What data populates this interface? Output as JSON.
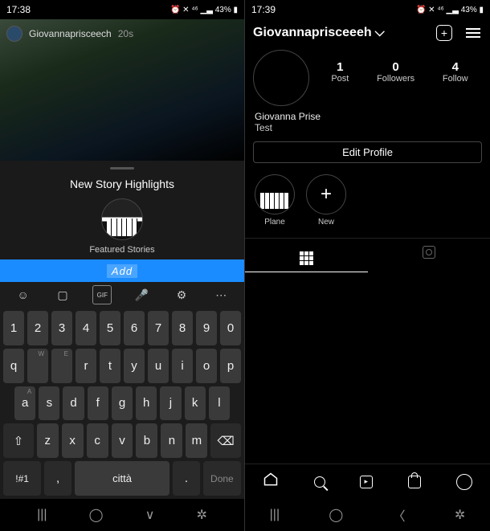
{
  "left": {
    "status": {
      "time": "17:38",
      "icons": "⏰ ✕ ⁴⁶ ▁▃ 43% ▮"
    },
    "story": {
      "user": "Giovannaprisceech",
      "age": "20s"
    },
    "sheet": {
      "title": "New Story Highlights",
      "subtitle": "Featured Stories",
      "add": "Add"
    },
    "kb": {
      "row1": [
        "1",
        "2",
        "3",
        "4",
        "5",
        "6",
        "7",
        "8",
        "9",
        "0"
      ],
      "row2": [
        "q",
        "w",
        "e",
        "r",
        "t",
        "y",
        "u",
        "i",
        "o",
        "p"
      ],
      "row3": [
        "a",
        "s",
        "d",
        "f",
        "g",
        "h",
        "j",
        "k",
        "l"
      ],
      "row4_shift": "⇧",
      "row4": [
        "z",
        "x",
        "c",
        "v",
        "b",
        "n",
        "m"
      ],
      "row4_bksp": "⌫",
      "row5": {
        "sym": "!#1",
        "comma": ",",
        "space": "città",
        "period": ".",
        "done": "Done"
      }
    }
  },
  "right": {
    "status": {
      "time": "17:39",
      "icons": "⏰ ✕ ⁴⁶ ▁▃ 43% ▮"
    },
    "username": "Giovannaprisceeeh",
    "stats": {
      "posts": {
        "num": "1",
        "label": "Post"
      },
      "followers": {
        "num": "0",
        "label": "Followers"
      },
      "following": {
        "num": "4",
        "label": "Follow"
      }
    },
    "bio": {
      "name": "Giovanna Prise",
      "line2": "Test"
    },
    "edit": "Edit Profile",
    "highlights": [
      {
        "label": "Plane",
        "type": "cover"
      },
      {
        "label": "New",
        "type": "add"
      }
    ]
  }
}
